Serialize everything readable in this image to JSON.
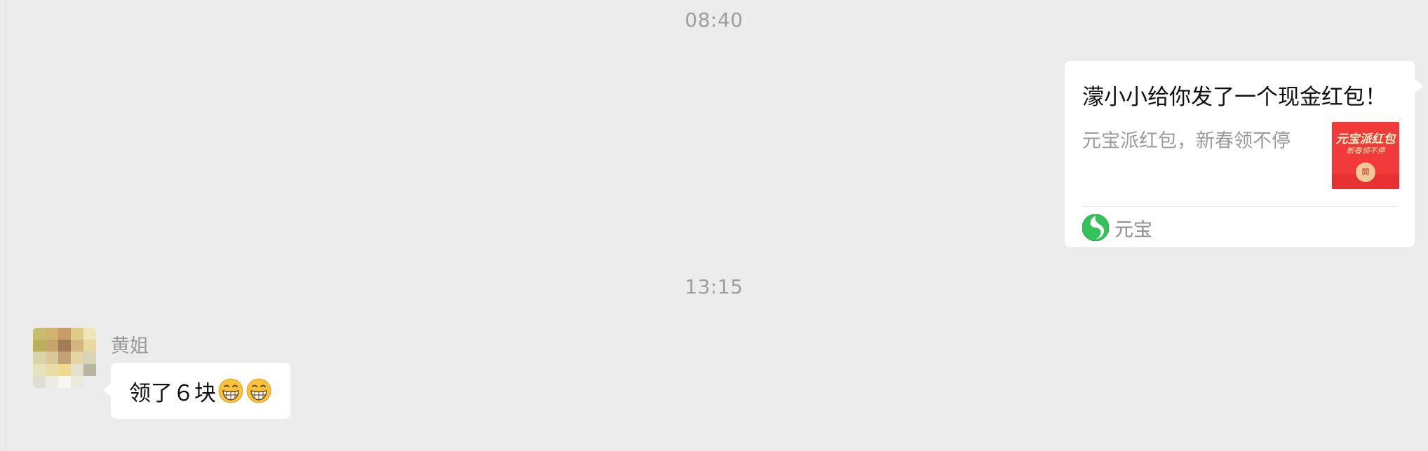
{
  "chat": {
    "timestamps": [
      "08:40",
      "13:15"
    ],
    "outgoing_card": {
      "title": "濛小小给你发了一个现金红包！",
      "description": "元宝派红包，新春领不停",
      "thumbnail": {
        "title": "元宝派红包",
        "subtitle": "新春领不停",
        "button_label": "開"
      },
      "source_label": "元宝",
      "source_icon": "yuanbao-logo-icon"
    },
    "incoming_message": {
      "sender_name": "黄姐",
      "text": "领了６块",
      "emoji": [
        "grinning-face-icon",
        "grinning-face-icon"
      ]
    }
  },
  "colors": {
    "background": "#ececec",
    "bubble": "#ffffff",
    "red_packet": "#f23a3a",
    "source_green": "#2fb94f",
    "timestamp_text": "#9e9e9e"
  }
}
